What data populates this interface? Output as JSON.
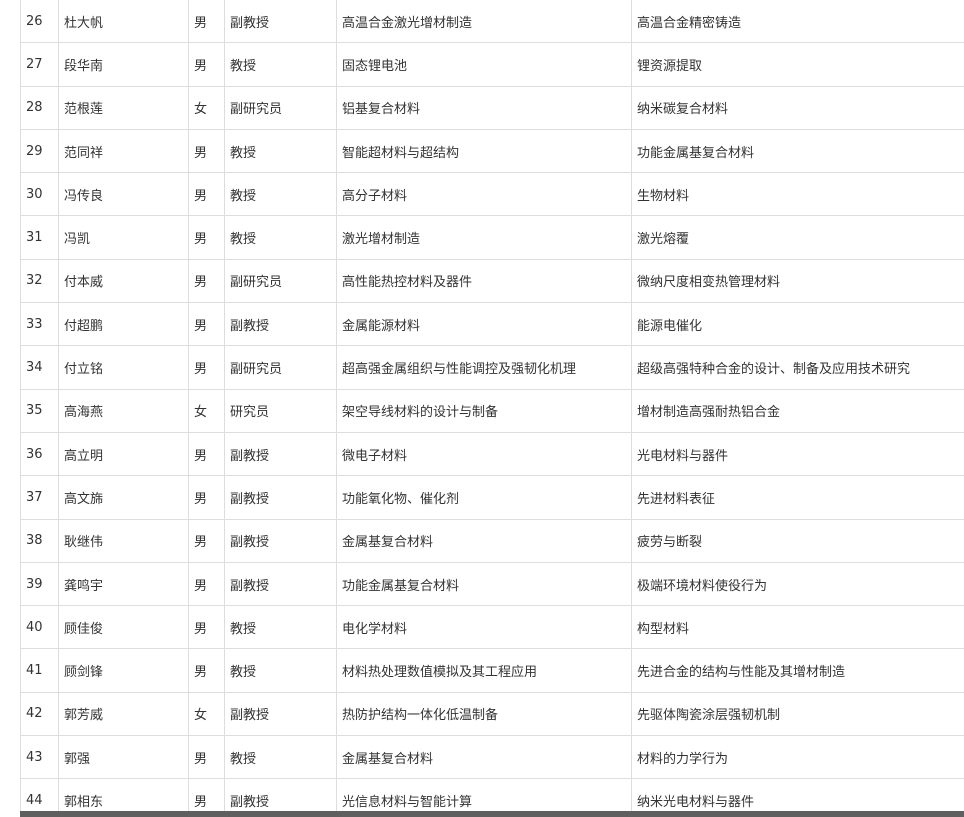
{
  "table": {
    "rows": [
      {
        "no": "26",
        "name": "杜大帆",
        "gender": "男",
        "title": "副教授",
        "direction1": "高温合金激光增材制造",
        "direction2": "高温合金精密铸造"
      },
      {
        "no": "27",
        "name": "段华南",
        "gender": "男",
        "title": "教授",
        "direction1": "固态锂电池",
        "direction2": "锂资源提取"
      },
      {
        "no": "28",
        "name": "范根莲",
        "gender": "女",
        "title": "副研究员",
        "direction1": "铝基复合材料",
        "direction2": "纳米碳复合材料"
      },
      {
        "no": "29",
        "name": "范同祥",
        "gender": "男",
        "title": "教授",
        "direction1": "智能超材料与超结构",
        "direction2": "功能金属基复合材料"
      },
      {
        "no": "30",
        "name": "冯传良",
        "gender": "男",
        "title": "教授",
        "direction1": "高分子材料",
        "direction2": "生物材料"
      },
      {
        "no": "31",
        "name": "冯凯",
        "gender": "男",
        "title": "教授",
        "direction1": "激光增材制造",
        "direction2": "激光熔覆"
      },
      {
        "no": "32",
        "name": "付本威",
        "gender": "男",
        "title": "副研究员",
        "direction1": "高性能热控材料及器件",
        "direction2": "微纳尺度相变热管理材料"
      },
      {
        "no": "33",
        "name": "付超鹏",
        "gender": "男",
        "title": "副教授",
        "direction1": "金属能源材料",
        "direction2": "能源电催化"
      },
      {
        "no": "34",
        "name": "付立铭",
        "gender": "男",
        "title": "副研究员",
        "direction1": "超高强金属组织与性能调控及强韧化机理",
        "direction2": "超级高强特种合金的设计、制备及应用技术研究"
      },
      {
        "no": "35",
        "name": "高海燕",
        "gender": "女",
        "title": "研究员",
        "direction1": "架空导线材料的设计与制备",
        "direction2": "增材制造高强耐热铝合金"
      },
      {
        "no": "36",
        "name": "高立明",
        "gender": "男",
        "title": "副教授",
        "direction1": "微电子材料",
        "direction2": "光电材料与器件"
      },
      {
        "no": "37",
        "name": "高文旆",
        "gender": "男",
        "title": "副教授",
        "direction1": "功能氧化物、催化剂",
        "direction2": "先进材料表征"
      },
      {
        "no": "38",
        "name": "耿继伟",
        "gender": "男",
        "title": "副教授",
        "direction1": "金属基复合材料",
        "direction2": "疲劳与断裂"
      },
      {
        "no": "39",
        "name": "龚鸣宇",
        "gender": "男",
        "title": "副教授",
        "direction1": "功能金属基复合材料",
        "direction2": "极端环境材料使役行为"
      },
      {
        "no": "40",
        "name": "顾佳俊",
        "gender": "男",
        "title": "教授",
        "direction1": "电化学材料",
        "direction2": "构型材料"
      },
      {
        "no": "41",
        "name": "顾剑锋",
        "gender": "男",
        "title": "教授",
        "direction1": "材料热处理数值模拟及其工程应用",
        "direction2": "先进合金的结构与性能及其增材制造"
      },
      {
        "no": "42",
        "name": "郭芳威",
        "gender": "女",
        "title": "副教授",
        "direction1": "热防护结构一体化低温制备",
        "direction2": "先驱体陶瓷涂层强韧机制"
      },
      {
        "no": "43",
        "name": "郭强",
        "gender": "男",
        "title": "教授",
        "direction1": "金属基复合材料",
        "direction2": "材料的力学行为"
      },
      {
        "no": "44",
        "name": "郭相东",
        "gender": "男",
        "title": "副教授",
        "direction1": "光信息材料与智能计算",
        "direction2": "纳米光电材料与器件"
      }
    ]
  }
}
